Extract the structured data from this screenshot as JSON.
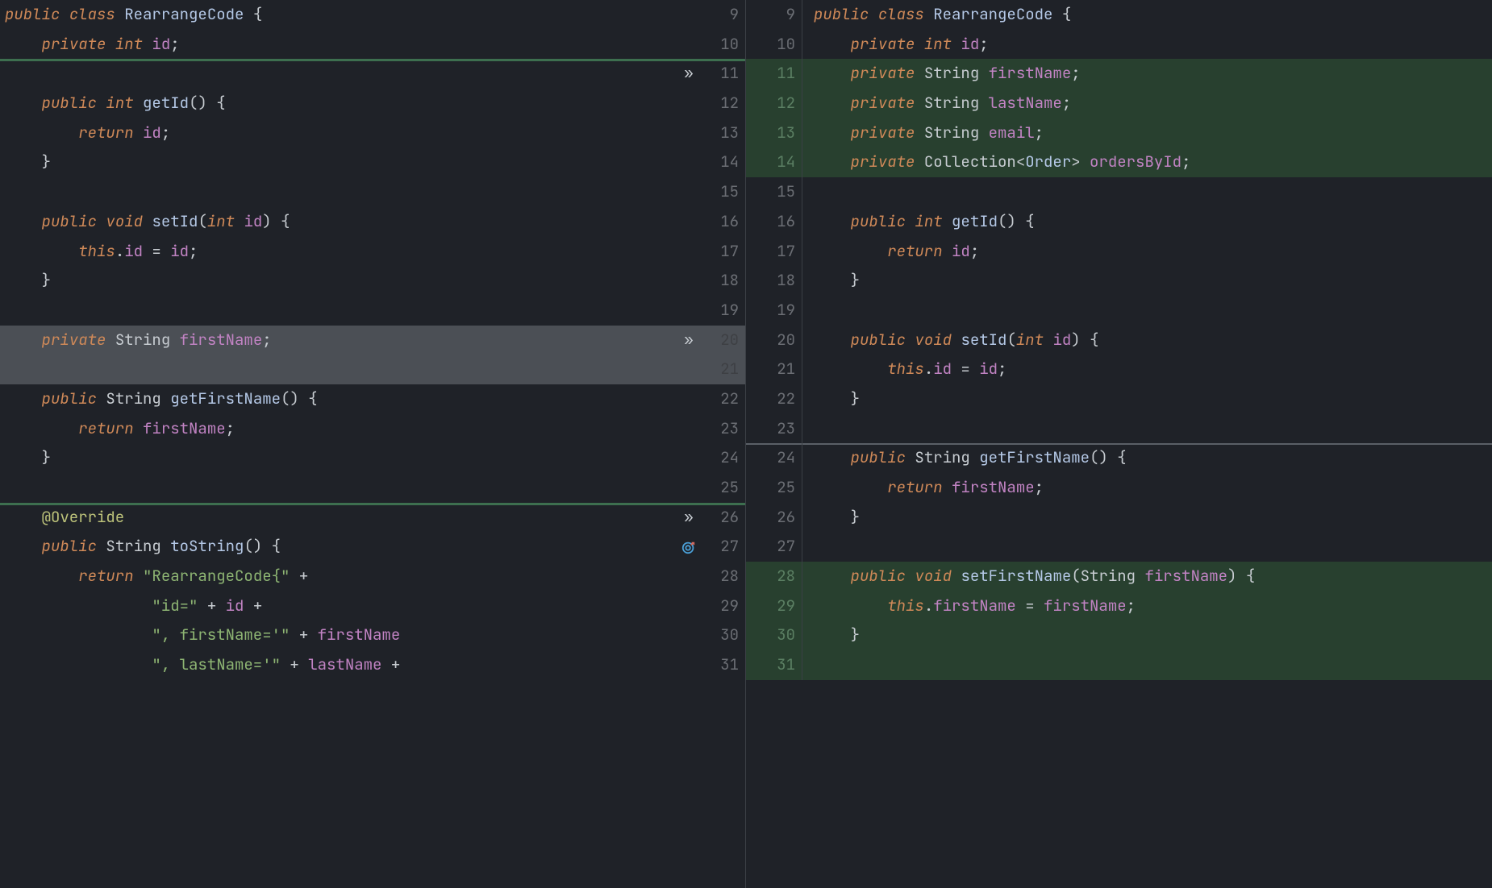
{
  "left": {
    "lines": [
      {
        "n": "9",
        "marker": "",
        "hl": "",
        "code": [
          [
            "kw",
            "public "
          ],
          [
            "kw",
            "class "
          ],
          [
            "type",
            "RearrangeCode "
          ],
          [
            "",
            "{"
          ]
        ]
      },
      {
        "n": "10",
        "marker": "",
        "hl": "",
        "code": [
          [
            "",
            "    "
          ],
          [
            "kw",
            "private "
          ],
          [
            "kw",
            "int "
          ],
          [
            "id",
            "id"
          ],
          [
            "",
            ";"
          ]
        ]
      },
      {
        "n": "11",
        "marker": "»",
        "hl": "",
        "code": [
          [
            "",
            ""
          ]
        ]
      },
      {
        "n": "12",
        "marker": "",
        "hl": "",
        "code": [
          [
            "",
            "    "
          ],
          [
            "kw",
            "public "
          ],
          [
            "kw",
            "int "
          ],
          [
            "type",
            "getId"
          ],
          [
            "",
            "() {"
          ]
        ]
      },
      {
        "n": "13",
        "marker": "",
        "hl": "",
        "code": [
          [
            "",
            "        "
          ],
          [
            "kw",
            "return "
          ],
          [
            "id",
            "id"
          ],
          [
            "",
            ";"
          ]
        ]
      },
      {
        "n": "14",
        "marker": "",
        "hl": "",
        "code": [
          [
            "",
            "    }"
          ]
        ]
      },
      {
        "n": "15",
        "marker": "",
        "hl": "",
        "code": [
          [
            "",
            ""
          ]
        ]
      },
      {
        "n": "16",
        "marker": "",
        "hl": "",
        "code": [
          [
            "",
            "    "
          ],
          [
            "kw",
            "public "
          ],
          [
            "kw",
            "void "
          ],
          [
            "type",
            "setId"
          ],
          [
            "",
            "("
          ],
          [
            "kw",
            "int "
          ],
          [
            "id",
            "id"
          ],
          [
            "",
            ") {"
          ]
        ]
      },
      {
        "n": "17",
        "marker": "",
        "hl": "",
        "code": [
          [
            "",
            "        "
          ],
          [
            "kw",
            "this"
          ],
          [
            "",
            "."
          ],
          [
            "id",
            "id"
          ],
          [
            "",
            ""
          ],
          [
            "",
            " = "
          ],
          [
            "id",
            "id"
          ],
          [
            "",
            ";"
          ]
        ]
      },
      {
        "n": "18",
        "marker": "",
        "hl": "",
        "code": [
          [
            "",
            "    }"
          ]
        ]
      },
      {
        "n": "19",
        "marker": "",
        "hl": "",
        "code": [
          [
            "",
            ""
          ]
        ]
      },
      {
        "n": "20",
        "marker": "»",
        "hl": "sel",
        "code": [
          [
            "",
            "    "
          ],
          [
            "kw",
            "private "
          ],
          [
            "",
            "String "
          ],
          [
            "id",
            "firstName"
          ],
          [
            "",
            ";"
          ]
        ]
      },
      {
        "n": "21",
        "marker": "",
        "hl": "sel",
        "code": [
          [
            "",
            ""
          ]
        ]
      },
      {
        "n": "22",
        "marker": "",
        "hl": "",
        "code": [
          [
            "",
            "    "
          ],
          [
            "kw",
            "public "
          ],
          [
            "",
            "String "
          ],
          [
            "type",
            "getFirstName"
          ],
          [
            "",
            "() {"
          ]
        ]
      },
      {
        "n": "23",
        "marker": "",
        "hl": "",
        "code": [
          [
            "",
            "        "
          ],
          [
            "kw",
            "return "
          ],
          [
            "id",
            "firstName"
          ],
          [
            "",
            ";"
          ]
        ]
      },
      {
        "n": "24",
        "marker": "",
        "hl": "",
        "code": [
          [
            "",
            "    }"
          ]
        ]
      },
      {
        "n": "25",
        "marker": "",
        "hl": "",
        "code": [
          [
            "",
            ""
          ]
        ]
      },
      {
        "n": "26",
        "marker": "»",
        "hl": "",
        "code": [
          [
            "",
            "    "
          ],
          [
            "anno",
            "@Override"
          ]
        ]
      },
      {
        "n": "27",
        "marker": "◎",
        "hl": "",
        "code": [
          [
            "",
            "    "
          ],
          [
            "kw",
            "public "
          ],
          [
            "",
            "String "
          ],
          [
            "type",
            "toString"
          ],
          [
            "",
            "() {"
          ]
        ]
      },
      {
        "n": "28",
        "marker": "",
        "hl": "",
        "code": [
          [
            "",
            "        "
          ],
          [
            "kw",
            "return "
          ],
          [
            "lit",
            "\"RearrangeCode{\" "
          ],
          [
            "",
            "+"
          ]
        ]
      },
      {
        "n": "29",
        "marker": "",
        "hl": "",
        "code": [
          [
            "",
            "                "
          ],
          [
            "lit",
            "\"id=\" "
          ],
          [
            "",
            "+ "
          ],
          [
            "id",
            "id "
          ],
          [
            "",
            "+"
          ]
        ]
      },
      {
        "n": "30",
        "marker": "",
        "hl": "",
        "code": [
          [
            "",
            "                "
          ],
          [
            "lit",
            "\", firstName='\" "
          ],
          [
            "",
            "+ "
          ],
          [
            "id",
            "firstName"
          ]
        ]
      },
      {
        "n": "31",
        "marker": "",
        "hl": "",
        "code": [
          [
            "",
            "                "
          ],
          [
            "lit",
            "\", lastName='\" "
          ],
          [
            "",
            "+ "
          ],
          [
            "id",
            "lastName "
          ],
          [
            "",
            "+"
          ]
        ]
      }
    ]
  },
  "right": {
    "lines": [
      {
        "n": "9",
        "hl": "",
        "code": [
          [
            "kw",
            "public "
          ],
          [
            "kw",
            "class "
          ],
          [
            "type",
            "RearrangeCode "
          ],
          [
            "",
            "{"
          ]
        ]
      },
      {
        "n": "10",
        "hl": "",
        "code": [
          [
            "",
            "    "
          ],
          [
            "kw",
            "private "
          ],
          [
            "kw",
            "int "
          ],
          [
            "id",
            "id"
          ],
          [
            "",
            ";"
          ]
        ]
      },
      {
        "n": "11",
        "hl": "add",
        "code": [
          [
            "",
            "    "
          ],
          [
            "kw",
            "private "
          ],
          [
            "",
            "String "
          ],
          [
            "id",
            "firstName"
          ],
          [
            "",
            ";"
          ]
        ]
      },
      {
        "n": "12",
        "hl": "add",
        "code": [
          [
            "",
            "    "
          ],
          [
            "kw",
            "private "
          ],
          [
            "",
            "String "
          ],
          [
            "id",
            "lastName"
          ],
          [
            "",
            ";"
          ]
        ]
      },
      {
        "n": "13",
        "hl": "add",
        "code": [
          [
            "",
            "    "
          ],
          [
            "kw",
            "private "
          ],
          [
            "",
            "String "
          ],
          [
            "id",
            "email"
          ],
          [
            "",
            ";"
          ]
        ]
      },
      {
        "n": "14",
        "hl": "add",
        "code": [
          [
            "",
            "    "
          ],
          [
            "kw",
            "private "
          ],
          [
            "",
            "Collection<"
          ],
          [
            "type",
            "Order"
          ],
          [
            "",
            "> "
          ],
          [
            "id",
            "ordersById"
          ],
          [
            "",
            ";"
          ]
        ]
      },
      {
        "n": "15",
        "hl": "",
        "code": [
          [
            "",
            ""
          ]
        ]
      },
      {
        "n": "16",
        "hl": "",
        "code": [
          [
            "",
            "    "
          ],
          [
            "kw",
            "public "
          ],
          [
            "kw",
            "int "
          ],
          [
            "type",
            "getId"
          ],
          [
            "",
            "() {"
          ]
        ]
      },
      {
        "n": "17",
        "hl": "",
        "code": [
          [
            "",
            "        "
          ],
          [
            "kw",
            "return "
          ],
          [
            "id",
            "id"
          ],
          [
            "",
            ";"
          ]
        ]
      },
      {
        "n": "18",
        "hl": "",
        "code": [
          [
            "",
            "    }"
          ]
        ]
      },
      {
        "n": "19",
        "hl": "",
        "code": [
          [
            "",
            ""
          ]
        ]
      },
      {
        "n": "20",
        "hl": "",
        "code": [
          [
            "",
            "    "
          ],
          [
            "kw",
            "public "
          ],
          [
            "kw",
            "void "
          ],
          [
            "type",
            "setId"
          ],
          [
            "",
            "("
          ],
          [
            "kw",
            "int "
          ],
          [
            "id",
            "id"
          ],
          [
            "",
            ") {"
          ]
        ]
      },
      {
        "n": "21",
        "hl": "",
        "code": [
          [
            "",
            "        "
          ],
          [
            "kw",
            "this"
          ],
          [
            "",
            "."
          ],
          [
            "id",
            "id"
          ],
          [
            "",
            " = "
          ],
          [
            "id",
            "id"
          ],
          [
            "",
            ";"
          ]
        ]
      },
      {
        "n": "22",
        "hl": "",
        "code": [
          [
            "",
            "    }"
          ]
        ]
      },
      {
        "n": "23",
        "hl": "",
        "code": [
          [
            "",
            ""
          ]
        ]
      },
      {
        "n": "24",
        "hl": "",
        "code": [
          [
            "",
            "    "
          ],
          [
            "kw",
            "public "
          ],
          [
            "",
            "String "
          ],
          [
            "type",
            "getFirstName"
          ],
          [
            "",
            "() {"
          ]
        ]
      },
      {
        "n": "25",
        "hl": "",
        "code": [
          [
            "",
            "        "
          ],
          [
            "kw",
            "return "
          ],
          [
            "id",
            "firstName"
          ],
          [
            "",
            ";"
          ]
        ]
      },
      {
        "n": "26",
        "hl": "",
        "code": [
          [
            "",
            "    }"
          ]
        ]
      },
      {
        "n": "27",
        "hl": "",
        "code": [
          [
            "",
            ""
          ]
        ]
      },
      {
        "n": "28",
        "hl": "add",
        "code": [
          [
            "",
            "    "
          ],
          [
            "kw",
            "public "
          ],
          [
            "kw",
            "void "
          ],
          [
            "type",
            "setFirstName"
          ],
          [
            "",
            "(String "
          ],
          [
            "id",
            "firstName"
          ],
          [
            "",
            ") {"
          ]
        ]
      },
      {
        "n": "29",
        "hl": "add",
        "code": [
          [
            "",
            "        "
          ],
          [
            "kw",
            "this"
          ],
          [
            "",
            "."
          ],
          [
            "id",
            "firstName"
          ],
          [
            "",
            " = "
          ],
          [
            "id",
            "firstName"
          ],
          [
            "",
            ";"
          ]
        ]
      },
      {
        "n": "30",
        "hl": "add",
        "code": [
          [
            "",
            "    }"
          ]
        ]
      },
      {
        "n": "31",
        "hl": "add",
        "code": [
          [
            "",
            ""
          ]
        ]
      }
    ]
  },
  "icons": {
    "chevron": "»",
    "bullseye": "◎"
  }
}
